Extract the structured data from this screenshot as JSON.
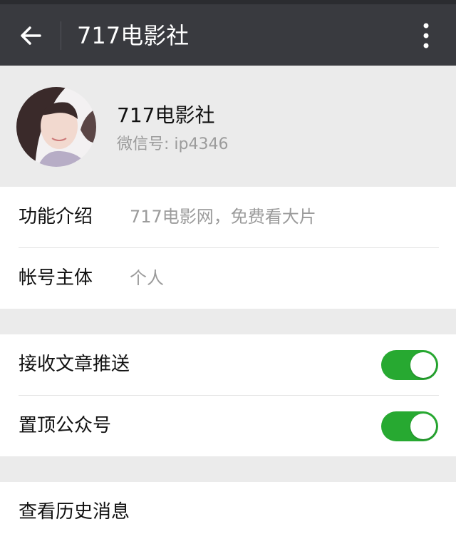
{
  "header": {
    "back_icon": "arrow-left-icon",
    "title": "717电影社",
    "more_icon": "more-vertical-icon"
  },
  "profile": {
    "avatar": "avatar-photo",
    "name": "717电影社",
    "wechat_id": "微信号: ip4346"
  },
  "info": {
    "function_label": "功能介绍",
    "function_value": "717电影网，免费看大片",
    "account_label": "帐号主体",
    "account_value": "个人"
  },
  "settings": {
    "receive_label": "接收文章推送",
    "receive_on": true,
    "pin_label": "置顶公众号",
    "pin_on": true
  },
  "history": {
    "label": "查看历史消息"
  },
  "colors": {
    "header_bg": "#393a3f",
    "toggle_on": "#27a931",
    "page_bg": "#ebebeb"
  }
}
